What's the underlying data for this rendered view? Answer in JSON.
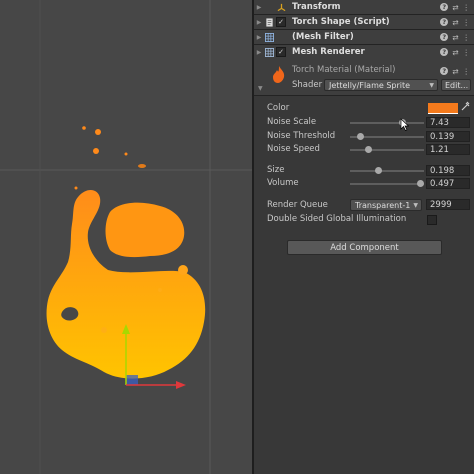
{
  "inspector": {
    "components": [
      {
        "name": "Transform",
        "icon": "transform-icon",
        "has_checkbox": false
      },
      {
        "name": "Torch Shape (Script)",
        "icon": "script-icon",
        "has_checkbox": true,
        "checked": true
      },
      {
        "name": "(Mesh Filter)",
        "icon": "mesh-filter-icon",
        "has_checkbox": false
      },
      {
        "name": "Mesh Renderer",
        "icon": "mesh-renderer-icon",
        "has_checkbox": true,
        "checked": true
      }
    ],
    "material": {
      "name": "Torch Material (Material)",
      "shader_label": "Shader",
      "shader_value": "Jettelly/Flame Sprite",
      "edit_label": "Edit..."
    },
    "properties": {
      "color_label": "Color",
      "color_value": "#f47a1c",
      "noise_scale": {
        "label": "Noise Scale",
        "value": "7.43",
        "slider_fraction": 0.72
      },
      "noise_threshold": {
        "label": "Noise Threshold",
        "value": "0.139",
        "slider_fraction": 0.14
      },
      "noise_speed": {
        "label": "Noise Speed",
        "value": "1.21",
        "slider_fraction": 0.24
      },
      "size": {
        "label": "Size",
        "value": "0.198",
        "slider_fraction": 0.4
      },
      "volume": {
        "label": "Volume",
        "value": "0.497",
        "slider_fraction": 0.97
      },
      "render_queue": {
        "label": "Render Queue",
        "dropdown": "Transparent-1",
        "value": "2999"
      },
      "double_sided": {
        "label": "Double Sided Global Illumination",
        "checked": false
      }
    },
    "add_component": "Add Component"
  },
  "colors": {
    "flame_top": "#ff8c1a",
    "flame_bottom": "#ffc400",
    "axis_x": "#e0383b",
    "axis_y": "#a8d800",
    "axis_z": "#3b6bd8"
  }
}
